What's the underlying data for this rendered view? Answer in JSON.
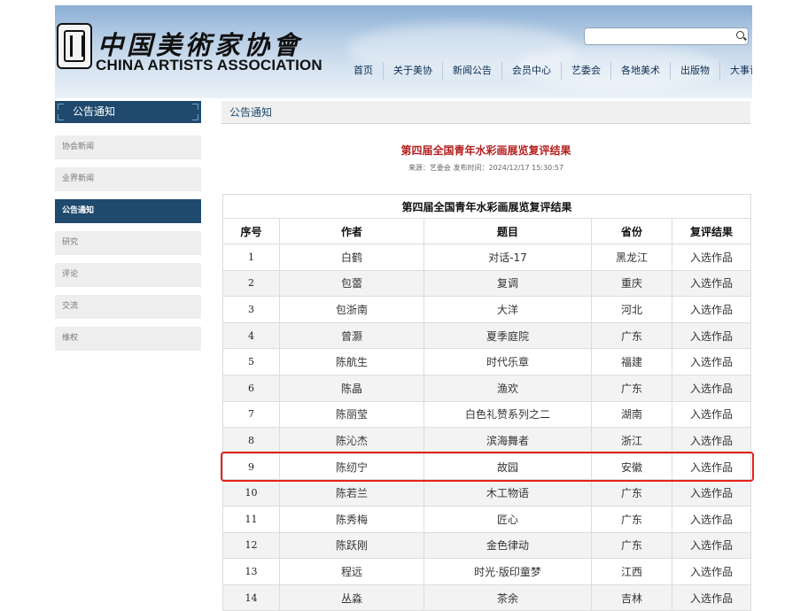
{
  "header": {
    "logo_cn": "中国美術家协會",
    "logo_en": "CHINA ARTISTS ASSOCIATION",
    "search_placeholder": "",
    "nav": [
      "首页",
      "关于美协",
      "新闻公告",
      "会员中心",
      "艺委会",
      "各地美术",
      "出版物",
      "大事记"
    ]
  },
  "sidebar": {
    "title": "公告通知",
    "items": [
      {
        "label": "协会新闻",
        "active": false
      },
      {
        "label": "业界新闻",
        "active": false
      },
      {
        "label": "公告通知",
        "active": true
      },
      {
        "label": "研究",
        "active": false
      },
      {
        "label": "评论",
        "active": false
      },
      {
        "label": "交流",
        "active": false
      },
      {
        "label": "维权",
        "active": false
      }
    ]
  },
  "content": {
    "breadcrumb": "公告通知",
    "article_title": "第四届全国青年水彩画展览复评结果",
    "article_meta": "来源：艺委会 发布时间：2024/12/17 15:30:57",
    "table": {
      "caption": "第四届全国青年水彩画展览复评结果",
      "headers": [
        "序号",
        "作者",
        "题目",
        "省份",
        "复评结果"
      ],
      "rows": [
        [
          "1",
          "白鹤",
          "对话-17",
          "黑龙江",
          "入选作品"
        ],
        [
          "2",
          "包蕾",
          "复调",
          "重庆",
          "入选作品"
        ],
        [
          "3",
          "包浙南",
          "大洋",
          "河北",
          "入选作品"
        ],
        [
          "4",
          "曾灏",
          "夏季庭院",
          "广东",
          "入选作品"
        ],
        [
          "5",
          "陈航生",
          "时代乐章",
          "福建",
          "入选作品"
        ],
        [
          "6",
          "陈晶",
          "渔欢",
          "广东",
          "入选作品"
        ],
        [
          "7",
          "陈丽莹",
          "白色礼赞系列之二",
          "湖南",
          "入选作品"
        ],
        [
          "8",
          "陈沁杰",
          "滨海舞者",
          "浙江",
          "入选作品"
        ],
        [
          "9",
          "陈纫宁",
          "故园",
          "安徽",
          "入选作品"
        ],
        [
          "10",
          "陈若兰",
          "木工物语",
          "广东",
          "入选作品"
        ],
        [
          "11",
          "陈秀梅",
          "匠心",
          "广东",
          "入选作品"
        ],
        [
          "12",
          "陈跃刚",
          "金色律动",
          "广东",
          "入选作品"
        ],
        [
          "13",
          "程远",
          "时光·版印童梦",
          "江西",
          "入选作品"
        ],
        [
          "14",
          "丛淼",
          "茶余",
          "吉林",
          "入选作品"
        ]
      ],
      "highlighted_row": 9
    }
  },
  "colors": {
    "sidebar_active": "#1f4a6e",
    "title_red": "#b42020",
    "highlight": "#e5231b"
  }
}
